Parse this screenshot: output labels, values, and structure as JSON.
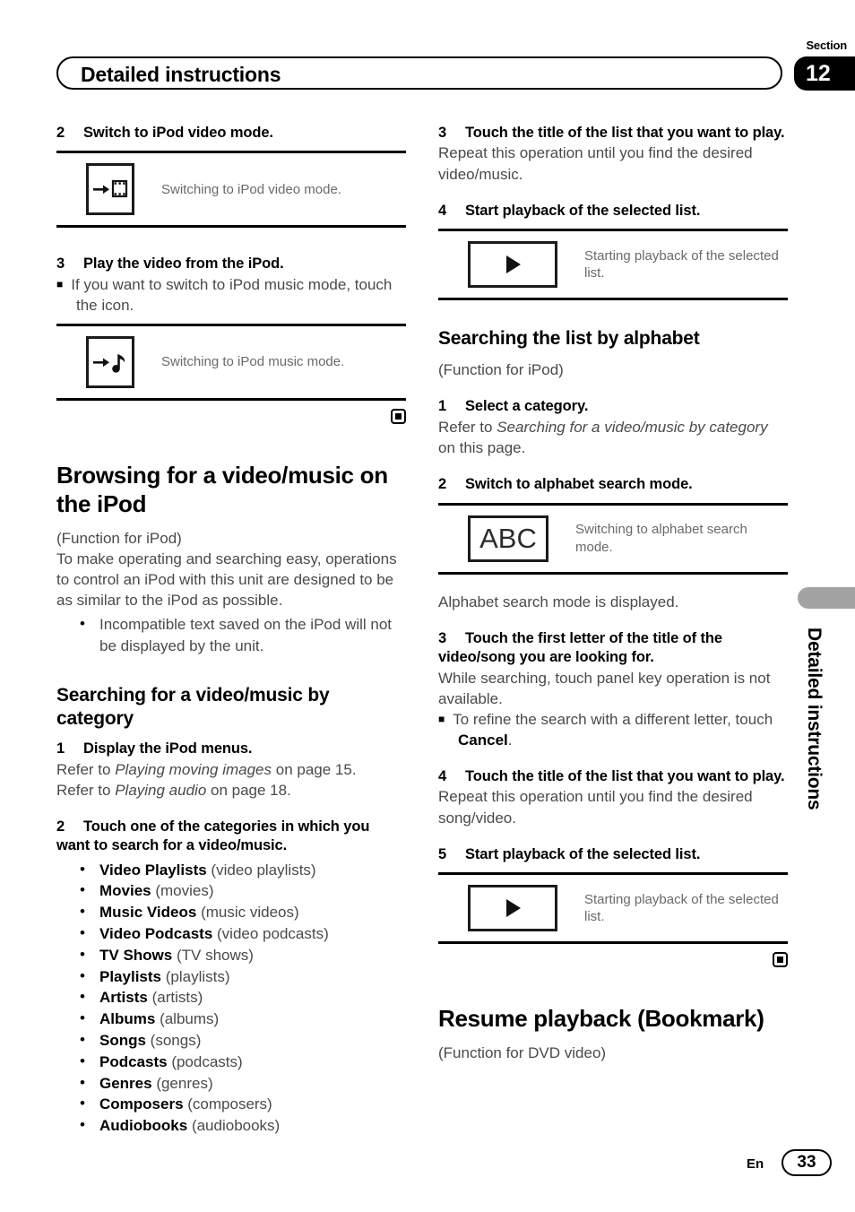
{
  "header": {
    "title": "Detailed instructions",
    "section_word": "Section",
    "section_number": "12"
  },
  "side": {
    "vertical_label": "Detailed instructions"
  },
  "footer": {
    "language": "En",
    "page_number": "33"
  },
  "left_column": {
    "step2": {
      "num": "2",
      "text": "Switch to iPod video mode."
    },
    "panel_video": {
      "icon": "arrow-film-icon",
      "caption": "Switching to iPod video mode."
    },
    "step3": {
      "num": "3",
      "text": "Play the video from the iPod."
    },
    "note3": "If you want to switch to iPod music mode, touch the icon.",
    "panel_music": {
      "icon": "arrow-music-note-icon",
      "caption": "Switching to iPod music mode."
    },
    "heading_browsing": "Browsing for a video/music on the iPod",
    "browsing_function": "(Function for iPod)",
    "browsing_body": "To make operating and searching easy, operations to control an iPod with this unit are designed to be as similar to the iPod as possible.",
    "browsing_bullet": "Incompatible text saved on the iPod will not be displayed by the unit.",
    "heading_category": "Searching for a video/music by category",
    "cat_step1": {
      "num": "1",
      "text": "Display the iPod menus."
    },
    "cat_ref1_pre": "Refer to ",
    "cat_ref1_italic": "Playing moving images",
    "cat_ref1_post": " on page 15.",
    "cat_ref2_pre": "Refer to ",
    "cat_ref2_italic": "Playing audio",
    "cat_ref2_post": " on page 18.",
    "cat_step2": {
      "num": "2",
      "text": "Touch one of the categories in which you want to search for a video/music."
    },
    "categories": [
      {
        "name": "Video Playlists",
        "paren": "(video playlists)"
      },
      {
        "name": "Movies",
        "paren": "(movies)"
      },
      {
        "name": "Music Videos",
        "paren": "(music videos)"
      },
      {
        "name": "Video Podcasts",
        "paren": "(video podcasts)"
      },
      {
        "name": "TV Shows",
        "paren": "(TV shows)"
      },
      {
        "name": "Playlists",
        "paren": "(playlists)"
      },
      {
        "name": "Artists",
        "paren": "(artists)"
      },
      {
        "name": "Albums",
        "paren": "(albums)"
      },
      {
        "name": "Songs",
        "paren": "(songs)"
      },
      {
        "name": "Podcasts",
        "paren": "(podcasts)"
      },
      {
        "name": "Genres",
        "paren": "(genres)"
      },
      {
        "name": "Composers",
        "paren": "(composers)"
      },
      {
        "name": "Audiobooks",
        "paren": "(audiobooks)"
      }
    ]
  },
  "right_column": {
    "step3": {
      "num": "3",
      "text": "Touch the title of the list that you want to play."
    },
    "step3_body": "Repeat this operation until you find the desired video/music.",
    "step4": {
      "num": "4",
      "text": "Start playback of the selected list."
    },
    "panel_play1": {
      "icon": "play-icon",
      "caption": "Starting playback of the selected list."
    },
    "heading_alphabet": "Searching the list by alphabet",
    "alphabet_function": "(Function for iPod)",
    "alpha_step1": {
      "num": "1",
      "text": "Select a category."
    },
    "alpha_ref_pre": "Refer to ",
    "alpha_ref_italic": "Searching for a video/music by category",
    "alpha_ref_post": " on this page.",
    "alpha_step2": {
      "num": "2",
      "text": "Switch to alphabet search mode."
    },
    "panel_abc": {
      "icon": "abc-icon",
      "label": "ABC",
      "caption": "Switching to alphabet search mode."
    },
    "alpha_after": "Alphabet search mode is displayed.",
    "alpha_step3": {
      "num": "3",
      "text": "Touch the first letter of the title of the video/song you are looking for."
    },
    "alpha_step3_body": "While searching, touch panel key operation is not available.",
    "alpha_step3_note_pre": "To refine the search with a different letter, touch ",
    "alpha_step3_note_bold": "Cancel",
    "alpha_step3_note_post": ".",
    "alpha_step4": {
      "num": "4",
      "text": "Touch the title of the list that you want to play."
    },
    "alpha_step4_body": "Repeat this operation until you find the desired song/video.",
    "alpha_step5": {
      "num": "5",
      "text": "Start playback of the selected list."
    },
    "panel_play2": {
      "icon": "play-icon",
      "caption": "Starting playback of the selected list."
    },
    "heading_resume": "Resume playback (Bookmark)",
    "resume_function": "(Function for DVD video)"
  }
}
